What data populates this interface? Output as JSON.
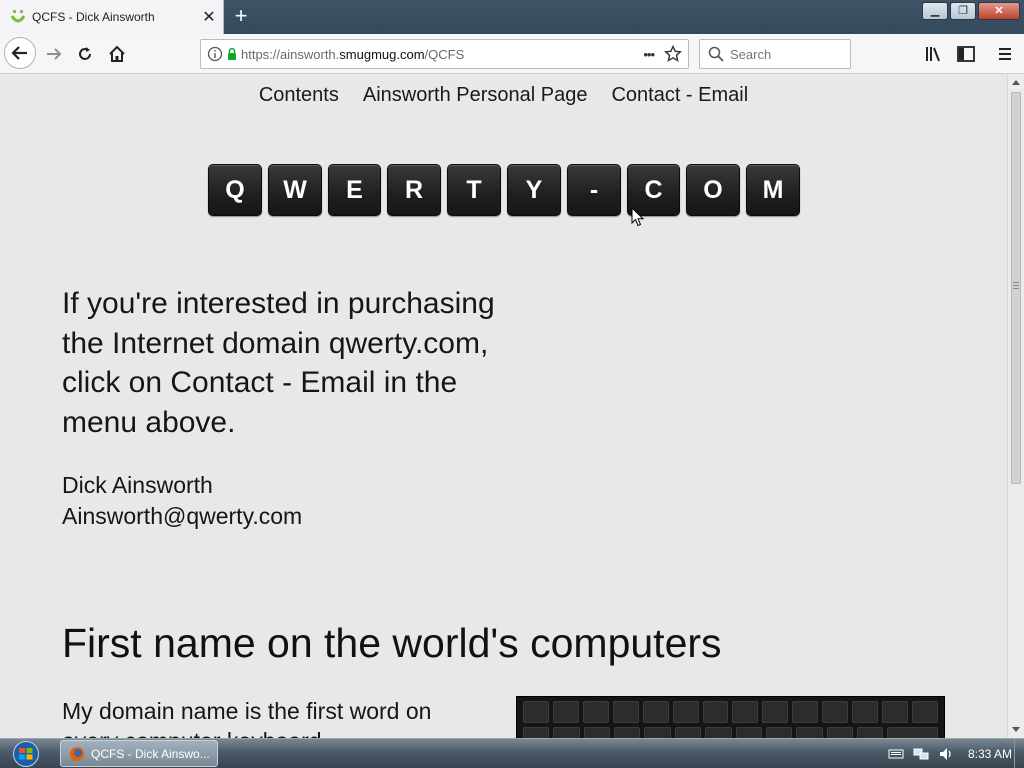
{
  "browser": {
    "tab_title": "QCFS - Dick Ainsworth",
    "tab_close": "✕",
    "new_tab": "+",
    "url_scheme_prefix": "https://ainsworth.",
    "url_domain": "smugmug.com",
    "url_path": "/QCFS",
    "search_placeholder": "Search",
    "page_actions": "•••"
  },
  "site_nav": {
    "items": [
      "Contents",
      "Ainsworth Personal Page",
      "Contact - Email"
    ]
  },
  "keys": [
    "Q",
    "W",
    "E",
    "R",
    "T",
    "Y",
    "-",
    "C",
    "O",
    "M"
  ],
  "promo": {
    "text": "If you're interested in purchasing the Internet domain qwerty.com, click on Contact - Email in the menu above."
  },
  "contact": {
    "name": "Dick Ainsworth",
    "email": "Ainsworth@qwerty.com"
  },
  "section": {
    "heading": "First name on the world's computers",
    "paragraph": "My domain name is the first word on every computer keyboard."
  },
  "taskbar": {
    "window_label": "QCFS - Dick Ainswo...",
    "clock": "8:33 AM"
  }
}
